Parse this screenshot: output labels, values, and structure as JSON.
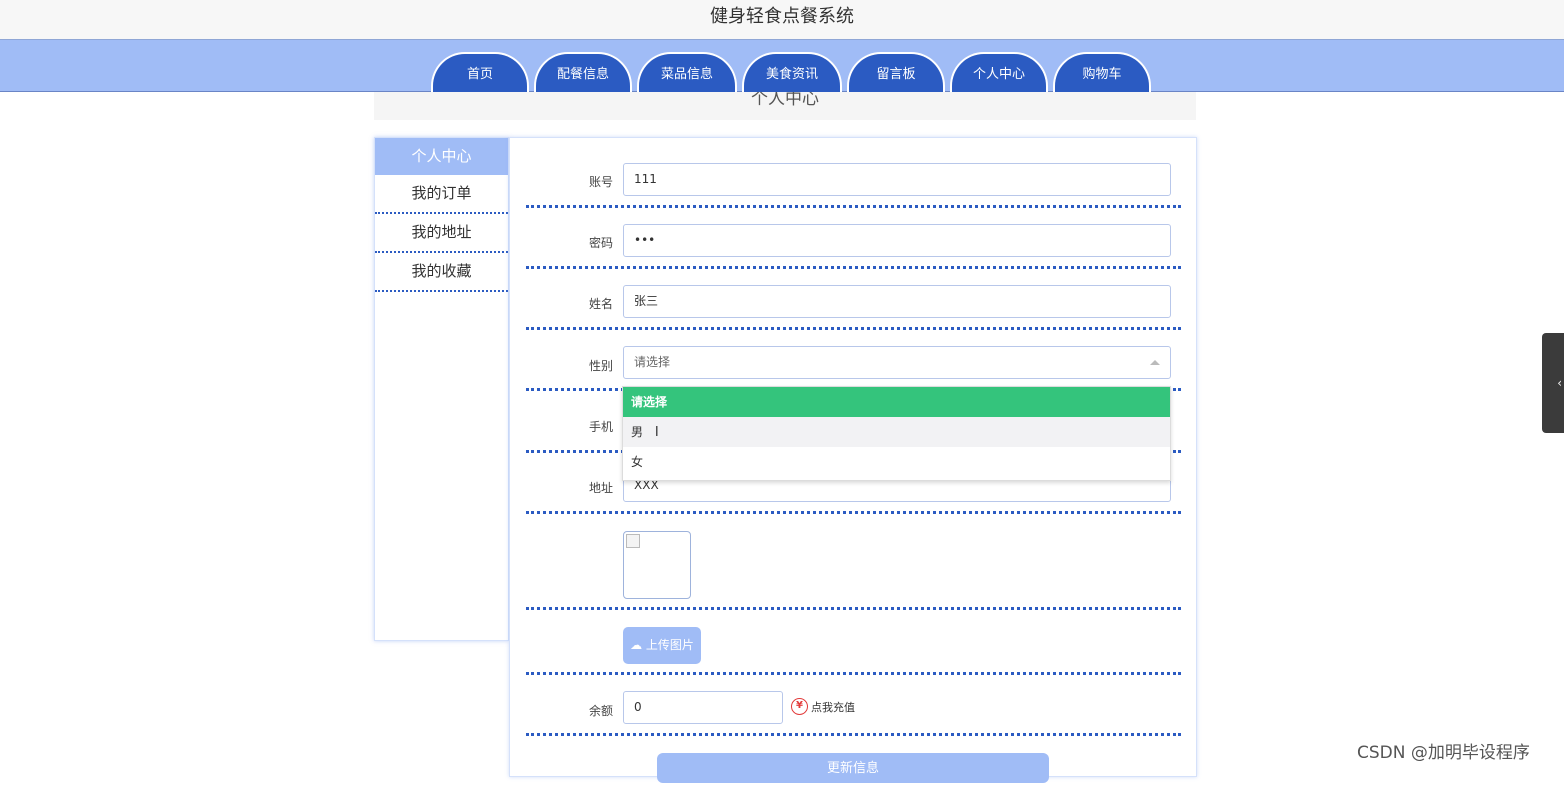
{
  "header": {
    "title": "健身轻食点餐系统"
  },
  "nav": {
    "tabs": [
      {
        "label": "首页"
      },
      {
        "label": "配餐信息"
      },
      {
        "label": "菜品信息"
      },
      {
        "label": "美食资讯"
      },
      {
        "label": "留言板"
      },
      {
        "label": "个人中心"
      },
      {
        "label": "购物车"
      }
    ]
  },
  "page": {
    "title": "个人中心"
  },
  "sidebar": {
    "items": [
      {
        "label": "个人中心"
      },
      {
        "label": "我的订单"
      },
      {
        "label": "我的地址"
      },
      {
        "label": "我的收藏"
      }
    ]
  },
  "form": {
    "account": {
      "label": "账号",
      "value": "111"
    },
    "password": {
      "label": "密码",
      "value": "•••"
    },
    "name": {
      "label": "姓名",
      "value": "张三"
    },
    "gender": {
      "label": "性别",
      "placeholder": "请选择",
      "options": [
        "请选择",
        "男",
        "女"
      ]
    },
    "phone": {
      "label": "手机"
    },
    "address": {
      "label": "地址",
      "value": "XXX"
    },
    "upload_label": "上传图片",
    "balance": {
      "label": "余额",
      "value": "0"
    },
    "recharge_label": "点我充值",
    "submit_label": "更新信息"
  },
  "icons": {
    "upload": "cloud-upload-icon",
    "yen": "yen-icon",
    "chevron": "chevron-left-icon"
  },
  "colors": {
    "nav_bg": "#a0bcf6",
    "tab_bg": "#2b5bc2",
    "selected_option": "#34c47c",
    "divider": "#2b5bc2"
  },
  "watermark": "CSDN @加明毕设程序"
}
